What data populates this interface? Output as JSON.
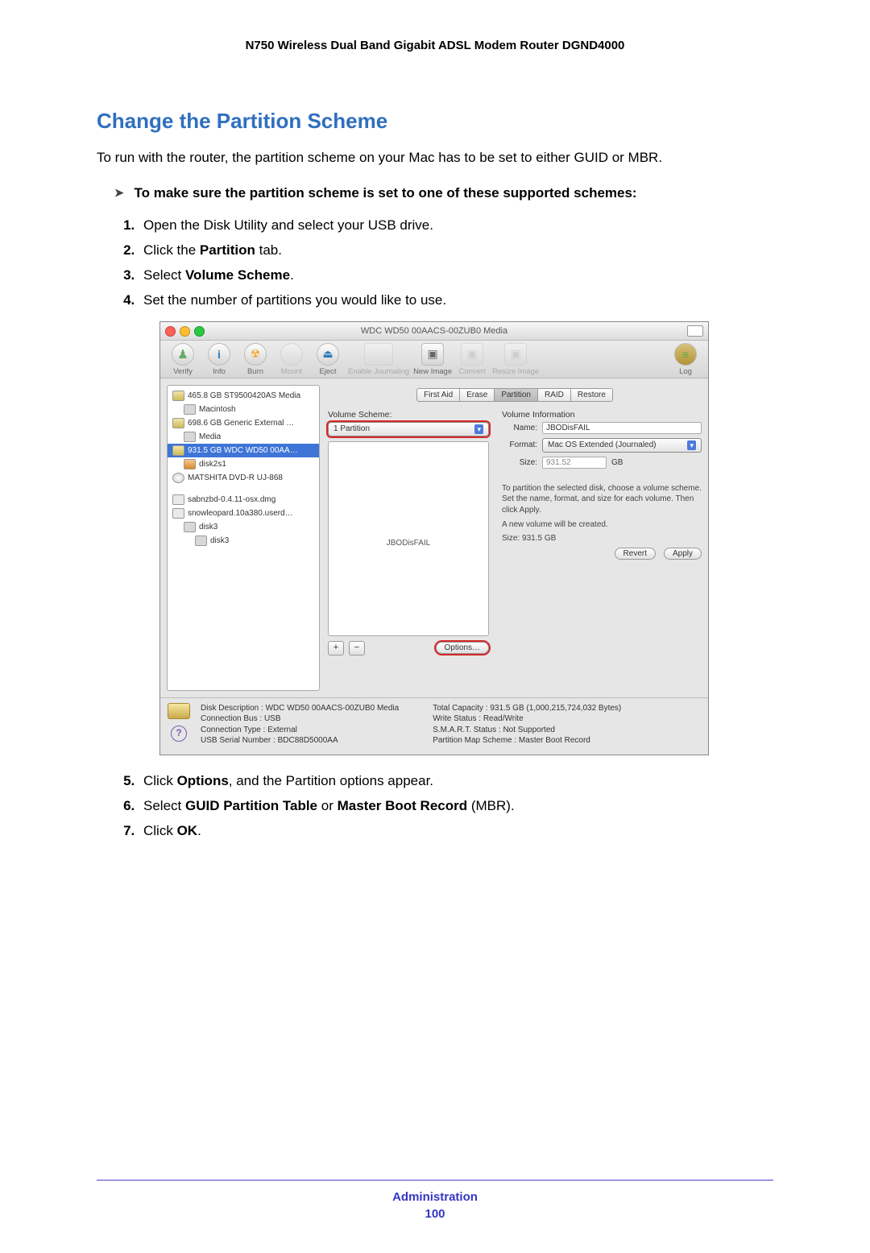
{
  "header": {
    "title": "N750 Wireless Dual Band Gigabit ADSL Modem Router DGND4000"
  },
  "section": {
    "title": "Change the Partition Scheme",
    "intro": "To run with the router, the partition scheme on your Mac has to be set to either GUID or MBR.",
    "task": "To make sure the partition scheme is set to one of these supported schemes:",
    "step1": "Open the Disk Utility and select your USB drive.",
    "step2_pre": "Click the ",
    "step2_b": "Partition",
    "step2_post": " tab.",
    "step3_pre": "Select ",
    "step3_b": "Volume Scheme",
    "step3_post": ".",
    "step4": "Set the number of partitions you would like to use.",
    "step5_pre": "Click ",
    "step5_b": "Options",
    "step5_post": ", and the Partition options appear.",
    "step6_pre": "Select ",
    "step6_b1": "GUID Partition Table",
    "step6_mid": " or ",
    "step6_b2": "Master Boot Record",
    "step6_post": " (MBR).",
    "step7_pre": "Click ",
    "step7_b": "OK",
    "step7_post": "."
  },
  "screenshot": {
    "window_title": "WDC WD50 00AACS-00ZUB0 Media",
    "toolbar": {
      "verify": "Verify",
      "info": "Info",
      "burn": "Burn",
      "mount": "Mount",
      "eject": "Eject",
      "enable_journaling": "Enable Journaling",
      "new_image": "New Image",
      "convert": "Convert",
      "resize_image": "Resize Image",
      "log": "Log"
    },
    "sidebar": [
      "465.8 GB ST9500420AS Media",
      "Macintosh",
      "698.6 GB Generic External …",
      "Media",
      "931.5 GB WDC WD50 00AA…",
      "disk2s1",
      "MATSHITA DVD-R UJ-868",
      "sabnzbd-0.4.11-osx.dmg",
      "snowleopard.10a380.userd…",
      "disk3",
      "disk3"
    ],
    "tabs": {
      "first_aid": "First Aid",
      "erase": "Erase",
      "partition": "Partition",
      "raid": "RAID",
      "restore": "Restore"
    },
    "volume_scheme_label": "Volume Scheme:",
    "volume_scheme_value": "1 Partition",
    "partition_label": "JBODisFAIL",
    "volume_info_label": "Volume Information",
    "name_label": "Name:",
    "name_value": "JBODisFAIL",
    "format_label": "Format:",
    "format_value": "Mac OS Extended (Journaled)",
    "size_label": "Size:",
    "size_value": "931.52",
    "size_unit": "GB",
    "note1": "To partition the selected disk, choose a volume scheme. Set the name, format, and size for each volume. Then click Apply.",
    "note2a": "A new volume will be created.",
    "note2b": "Size: 931.5 GB",
    "btn_plus": "+",
    "btn_minus": "−",
    "btn_options": "Options…",
    "btn_revert": "Revert",
    "btn_apply": "Apply",
    "footer": {
      "l1k": "Disk Description :",
      "l1v": "WDC WD50 00AACS-00ZUB0 Media",
      "l2k": "Connection Bus :",
      "l2v": "USB",
      "l3k": "Connection Type :",
      "l3v": "External",
      "l4k": "USB Serial Number :",
      "l4v": "BDC88D5000AA",
      "r1k": "Total Capacity :",
      "r1v": "931.5 GB (1,000,215,724,032 Bytes)",
      "r2k": "Write Status :",
      "r2v": "Read/Write",
      "r3k": "S.M.A.R.T. Status :",
      "r3v": "Not Supported",
      "r4k": "Partition Map Scheme :",
      "r4v": "Master Boot Record"
    }
  },
  "footer": {
    "section": "Administration",
    "page": "100"
  }
}
